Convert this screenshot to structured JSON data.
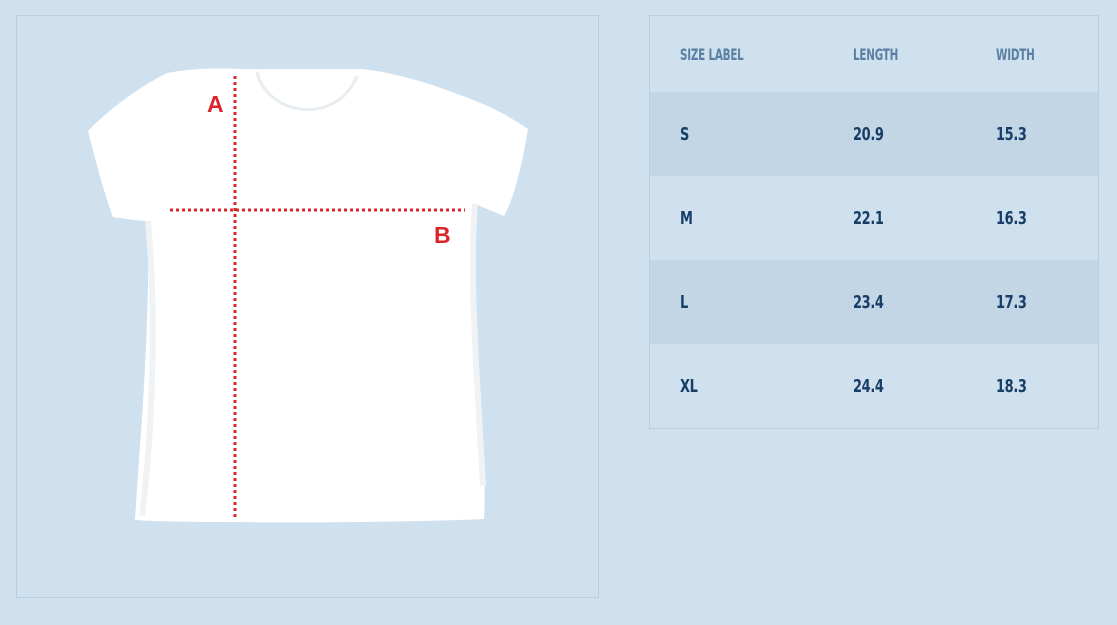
{
  "figure": {
    "marker_a": "A",
    "marker_b": "B",
    "marker_color": "#d8262b"
  },
  "table": {
    "headers": [
      "SIZE LABEL",
      "LENGTH",
      "WIDTH"
    ],
    "rows": [
      [
        "S",
        "20.9",
        "15.3"
      ],
      [
        "M",
        "22.1",
        "16.3"
      ],
      [
        "L",
        "23.4",
        "17.3"
      ],
      [
        "XL",
        "24.4",
        "18.3"
      ]
    ]
  },
  "colors": {
    "background": "#cfe0ee",
    "row_stripe": "#c2d6e6",
    "header_text": "#5a7fa3",
    "cell_text": "#173e66"
  }
}
